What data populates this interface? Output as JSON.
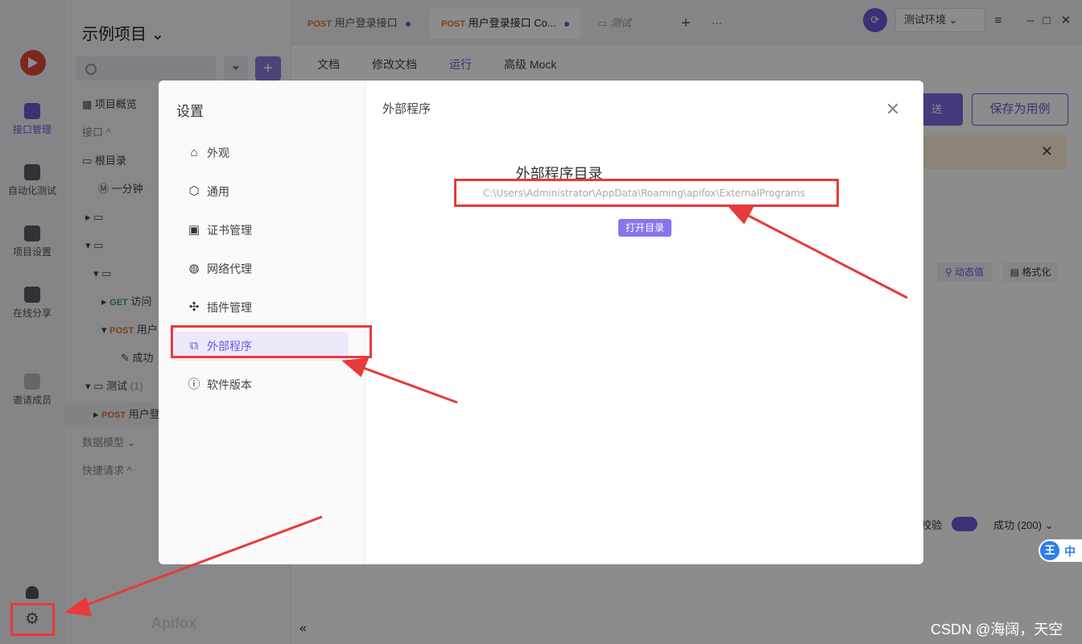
{
  "app": {
    "project_name": "示例项目",
    "brand": "Apifox",
    "watermark": "CSDN @海阔，天空"
  },
  "rail": {
    "items": [
      {
        "label": "接口管理",
        "active": true
      },
      {
        "label": "自动化测试"
      },
      {
        "label": "项目设置"
      },
      {
        "label": "在线分享"
      },
      {
        "label": "邀请成员"
      }
    ]
  },
  "sidebar": {
    "overview": "项目概览",
    "section_api": "接口 ^",
    "root": "根目录",
    "row_mock": "一分钟",
    "get_method": "GET",
    "get_label": "访问",
    "post_method": "POST",
    "post_label": "用户",
    "case_label": "成功",
    "test_folder": "测试",
    "test_count": "(1)",
    "post2_label": "用户登",
    "data_models": "数据模型",
    "quick_requests": "快捷请求"
  },
  "tabs": [
    {
      "method": "POST",
      "label": "用户登录接口"
    },
    {
      "method": "POST",
      "label": "用户登录接口 Co..."
    },
    {
      "label": "测试"
    }
  ],
  "env": {
    "label": "测试环境"
  },
  "subnav": [
    "文档",
    "修改文档",
    "运行",
    "高级 Mock"
  ],
  "content": {
    "send_label": "送",
    "save_case_label": "保存为用例",
    "dynamic_value": "动态值",
    "format": "格式化",
    "status_select": "成功 (200)",
    "validate": "校验"
  },
  "modal": {
    "title": "设置",
    "menu": [
      {
        "label": "外观",
        "icon": "shirt-icon"
      },
      {
        "label": "通用",
        "icon": "hexagon-icon"
      },
      {
        "label": "证书管理",
        "icon": "certificate-icon"
      },
      {
        "label": "网络代理",
        "icon": "globe-icon"
      },
      {
        "label": "插件管理",
        "icon": "puzzle-icon"
      },
      {
        "label": "外部程序",
        "icon": "copy-icon",
        "active": true
      },
      {
        "label": "软件版本",
        "icon": "info-icon"
      }
    ],
    "section_title": "外部程序",
    "dir_heading": "外部程序目录",
    "dir_path": "C:\\Users\\Administrator\\AppData\\Roaming\\apifox\\ExternalPrograms",
    "open_button": "打开目录"
  },
  "ime": {
    "icon": "王",
    "mode": "中"
  },
  "colors": {
    "accent": "#6b5bd6",
    "annotation": "#e83a3a"
  }
}
